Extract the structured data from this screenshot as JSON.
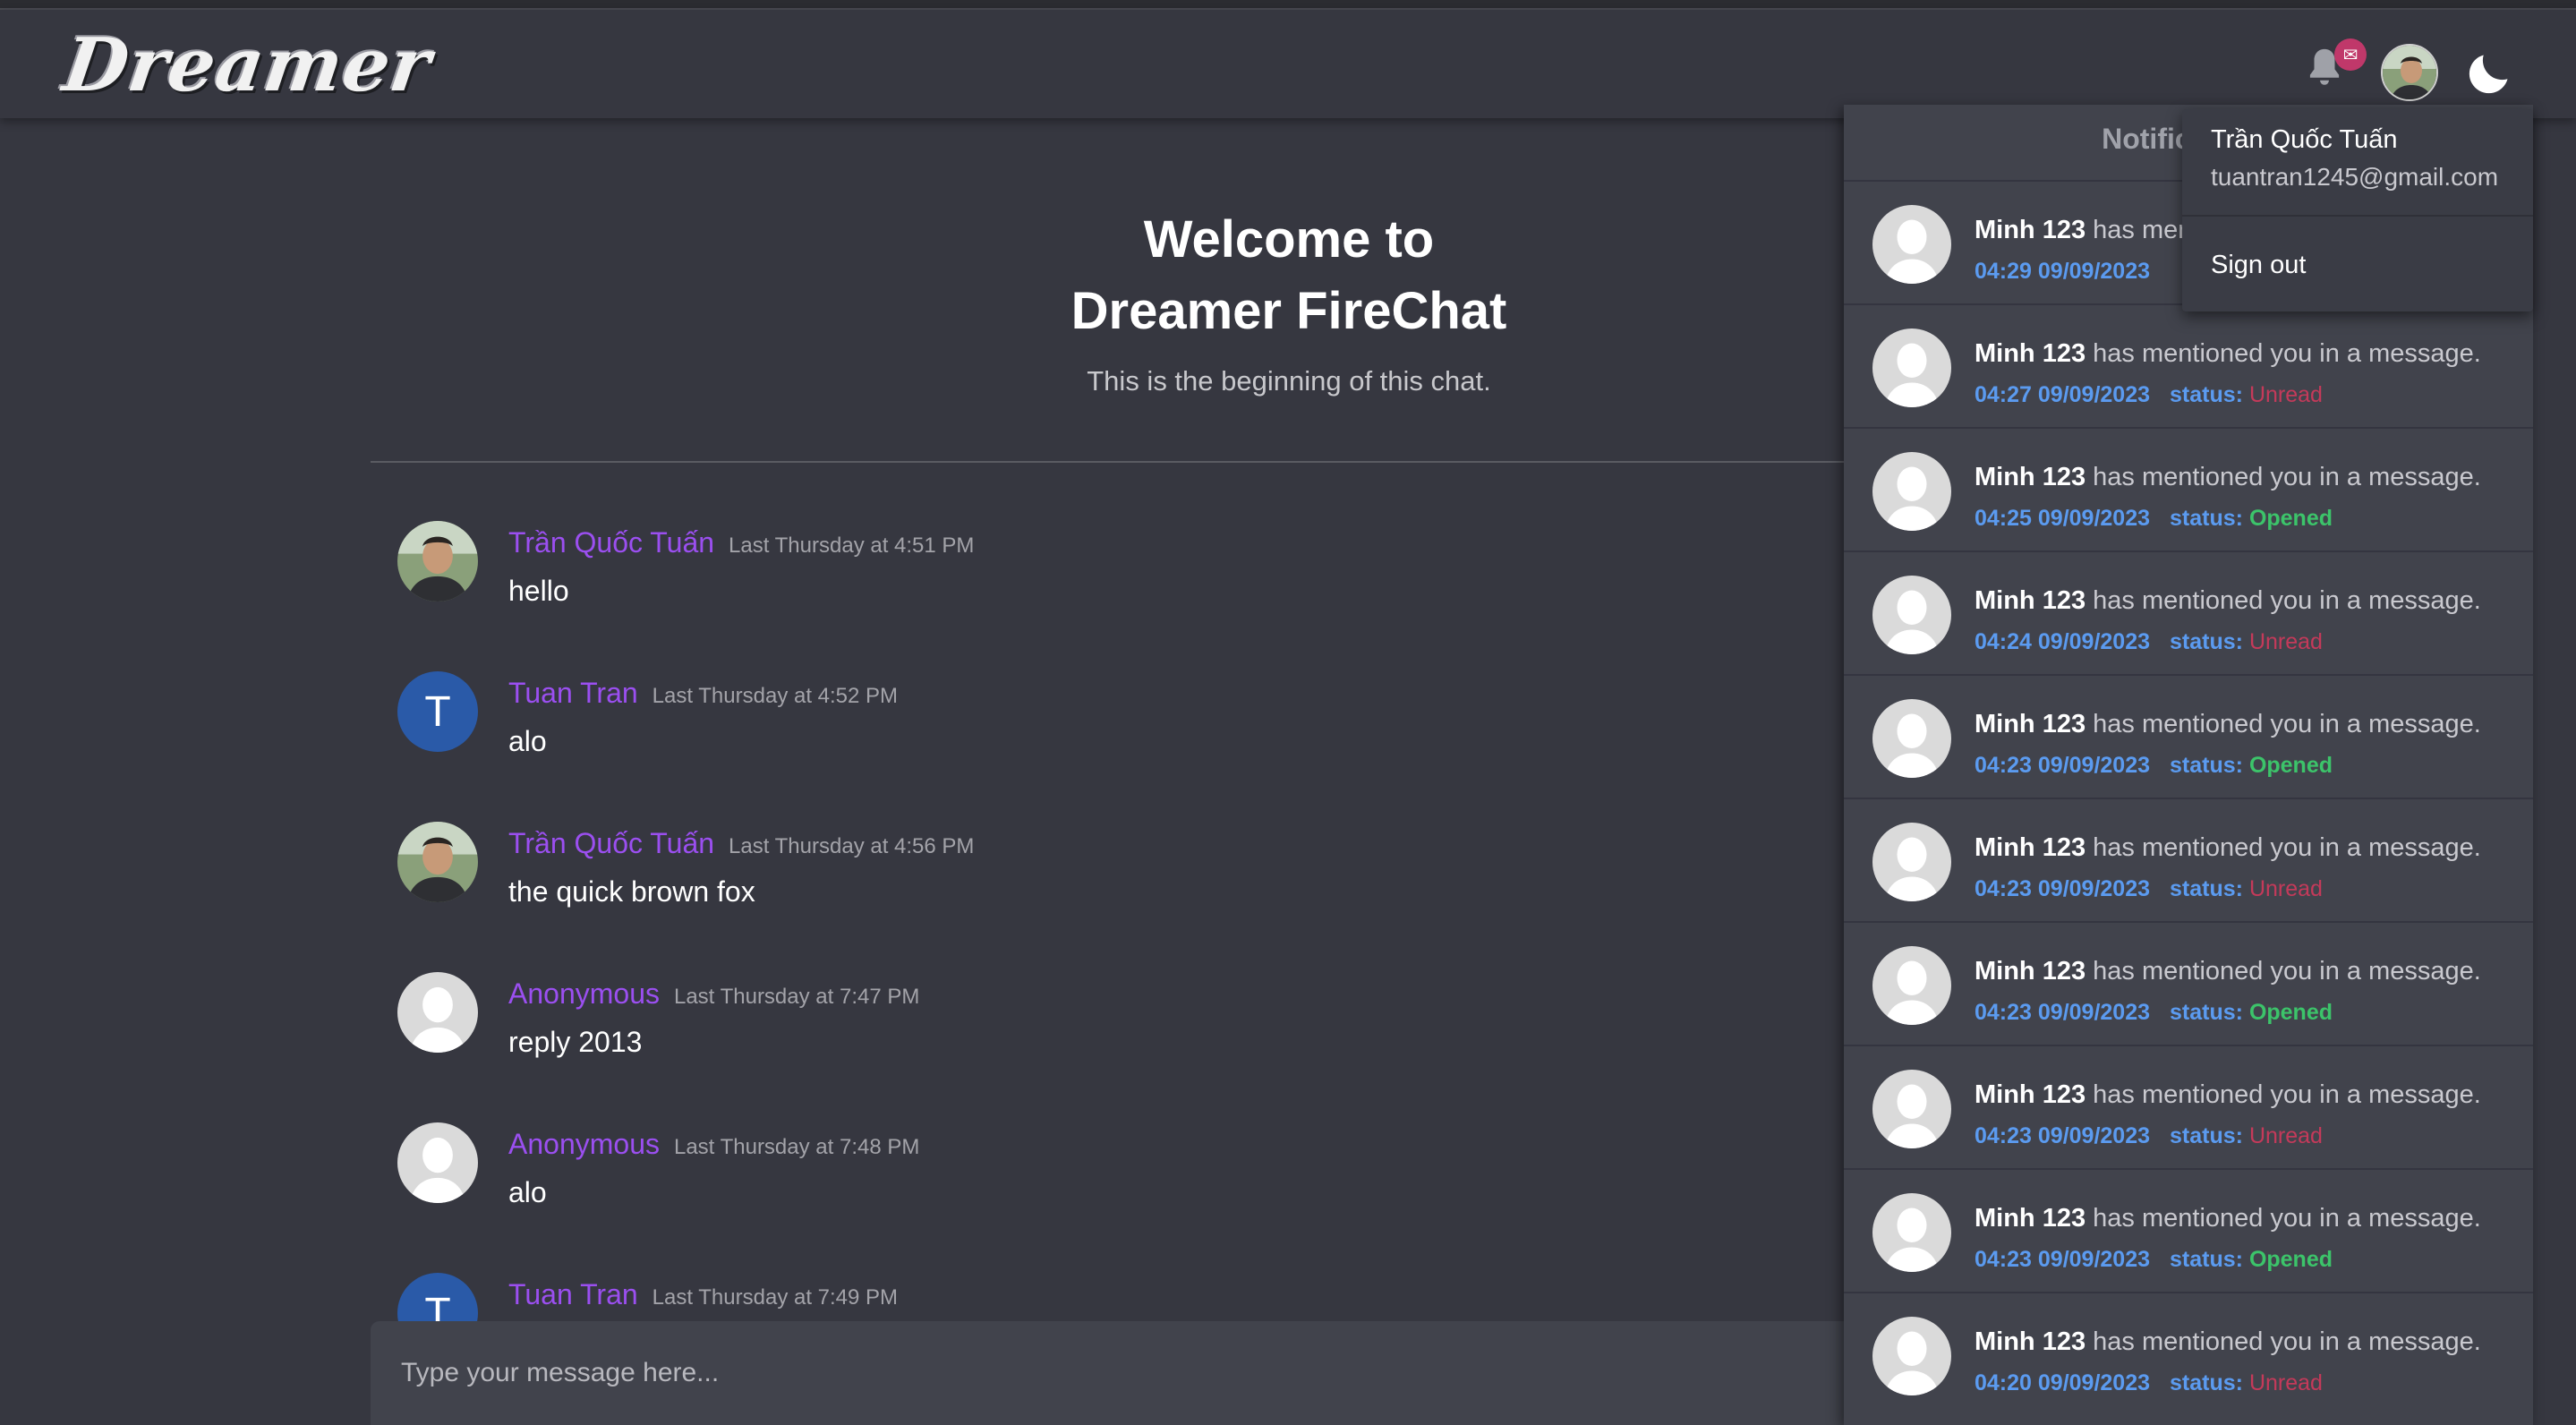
{
  "app": {
    "logo_text": "Dreamer",
    "notification_count": "✉"
  },
  "icons": {
    "bell": "bell-icon",
    "moon": "moon-icon"
  },
  "colors": {
    "username": "#9b4ff0",
    "timestamp_link": "#5b9bf0",
    "unread": "#c43a5a",
    "opened": "#3cc46a"
  },
  "welcome": {
    "line1": "Welcome to",
    "line2": "Dreamer FireChat",
    "subtitle": "This is the beginning of this chat."
  },
  "messages": [
    {
      "name": "Trần Quốc Tuấn",
      "time": "Last Thursday at 4:51 PM",
      "text": "hello"
    },
    {
      "name": "Tuan Tran",
      "time": "Last Thursday at 4:52 PM",
      "text": "alo",
      "initial": "T"
    },
    {
      "name": "Trần Quốc Tuấn",
      "time": "Last Thursday at 4:56 PM",
      "text": "the quick brown fox"
    },
    {
      "name": "Anonymous",
      "time": "Last Thursday at 7:47 PM",
      "text": "reply 2013"
    },
    {
      "name": "Anonymous",
      "time": "Last Thursday at 7:48 PM",
      "text": "alo"
    },
    {
      "name": "Tuan Tran",
      "time": "Last Thursday at 7:49 PM",
      "text": "",
      "initial": "T"
    }
  ],
  "composer": {
    "placeholder": "Type your message here..."
  },
  "notifications": {
    "title": "Notifications",
    "status_label": "status:",
    "items": [
      {
        "user": "Minh 123",
        "text": "has mentioned you in a message.",
        "time": "04:29 09/09/2023",
        "status": ""
      },
      {
        "user": "Minh 123",
        "text": "has mentioned you in a message.",
        "time": "04:27 09/09/2023",
        "status": "Unread"
      },
      {
        "user": "Minh 123",
        "text": "has mentioned you in a message.",
        "time": "04:25 09/09/2023",
        "status": "Opened"
      },
      {
        "user": "Minh 123",
        "text": "has mentioned you in a message.",
        "time": "04:24 09/09/2023",
        "status": "Unread"
      },
      {
        "user": "Minh 123",
        "text": "has mentioned you in a message.",
        "time": "04:23 09/09/2023",
        "status": "Opened"
      },
      {
        "user": "Minh 123",
        "text": "has mentioned you in a message.",
        "time": "04:23 09/09/2023",
        "status": "Unread"
      },
      {
        "user": "Minh 123",
        "text": "has mentioned you in a message.",
        "time": "04:23 09/09/2023",
        "status": "Opened"
      },
      {
        "user": "Minh 123",
        "text": "has mentioned you in a message.",
        "time": "04:23 09/09/2023",
        "status": "Unread"
      },
      {
        "user": "Minh 123",
        "text": "has mentioned you in a message.",
        "time": "04:23 09/09/2023",
        "status": "Opened"
      },
      {
        "user": "Minh 123",
        "text": "has mentioned you in a message.",
        "time": "04:20 09/09/2023",
        "status": "Unread"
      }
    ]
  },
  "user_menu": {
    "name": "Trần Quốc Tuấn",
    "email": "tuantran1245@gmail.com",
    "sign_out": "Sign out"
  }
}
